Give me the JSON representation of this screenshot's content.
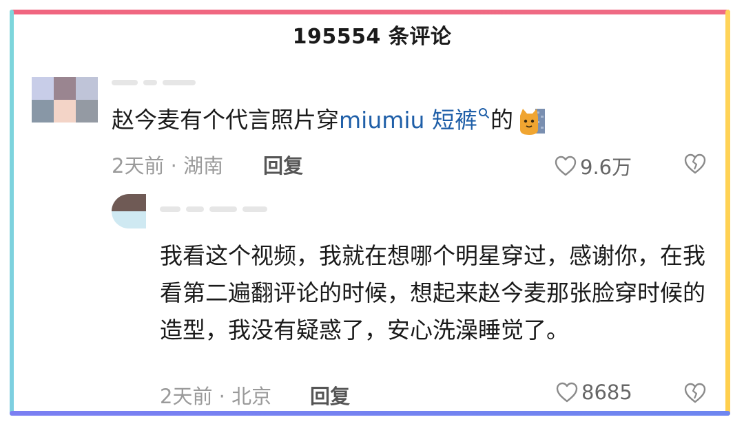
{
  "header": {
    "title": "195554 条评论"
  },
  "comments": [
    {
      "text_before": "赵今麦有个代言照片穿",
      "tag_text": "miumiu 短裤",
      "text_after": "的",
      "emoji": "cat-emoji",
      "time": "2天前",
      "location": "湖南",
      "reply_label": "回复",
      "likes": "9.6万",
      "avatar_colors": [
        "#c8cde8",
        "#9a8590",
        "#bfc4d8",
        "#8897a6",
        "#f3d4c7",
        "#949aa3"
      ]
    },
    {
      "text": "我看这个视频，我就在想哪个明星穿过，感谢你，在我看第二遍翻评论的时候，想起来赵今麦那张脸穿时候的造型，我没有疑惑了，安心洗澡睡觉了。",
      "time": "2天前",
      "location": "北京",
      "reply_label": "回复",
      "likes": "8685",
      "avatar_colors": [
        "#6f5a55",
        "#cfe9f2"
      ]
    }
  ],
  "colors": {
    "frame_top": "#f06680",
    "frame_left": "#7ed6dc",
    "frame_right": "#ffd45a",
    "frame_bottom": "#7b7ff2",
    "tag": "#1f5fa8",
    "meta": "#9a9a9a"
  },
  "icons": [
    "heart-outline-icon",
    "heart-broken-icon",
    "search-icon",
    "cat-emoji"
  ]
}
